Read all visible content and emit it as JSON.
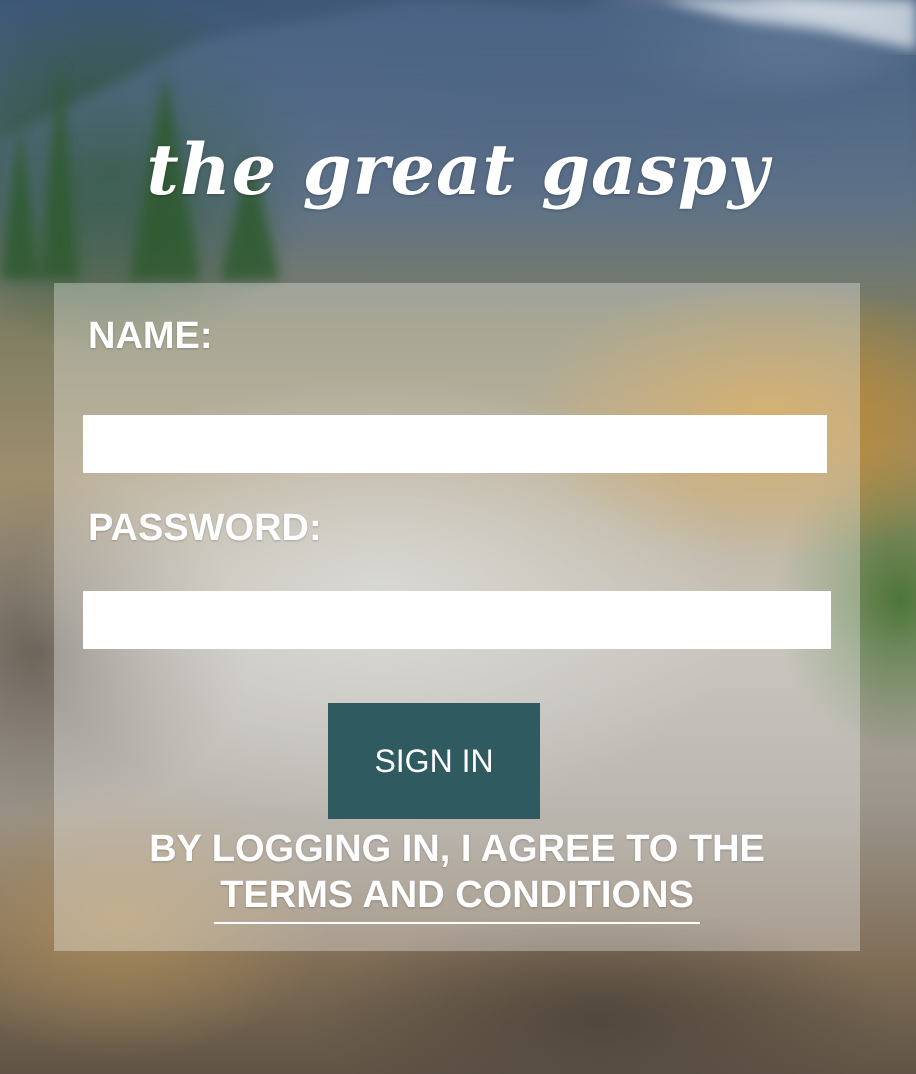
{
  "app": {
    "title": "the great gaspy"
  },
  "form": {
    "name_label": "NAME:",
    "name_value": "",
    "password_label": "PASSWORD:",
    "password_value": "",
    "signin_label": "SIGN IN",
    "terms_prefix": "BY LOGGING IN, I AGREE TO THE",
    "terms_link": "TERMS AND CONDITIONS"
  },
  "colors": {
    "button_bg": "#2f5b60",
    "panel_overlay": "rgba(255,255,255,0.32)",
    "text": "#ffffff"
  },
  "background": {
    "description_icon": "mountain-landscape-photo"
  }
}
